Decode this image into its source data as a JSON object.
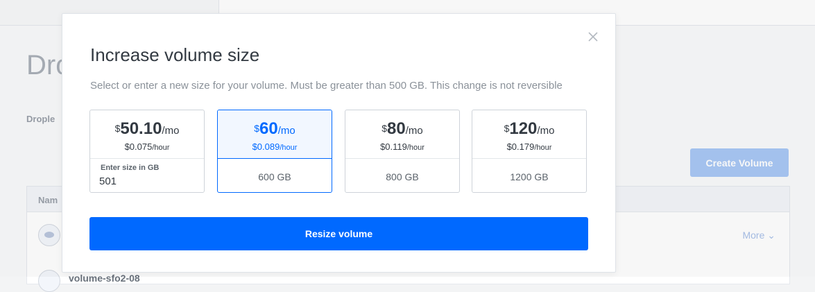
{
  "background": {
    "page_title": "Drop",
    "tab_label": "Drople",
    "create_button_label": "Create Volume",
    "table_col_name": "Nam",
    "row_more_label": "More",
    "row2_name": "volume-sfo2-08"
  },
  "modal": {
    "title": "Increase volume size",
    "description": "Select or enter a new size for your volume. Must be greater than 500 GB. This change is not reversible",
    "options": [
      {
        "currency": "$",
        "price": "50.10",
        "per_month": "/mo",
        "hourly": "$0.075",
        "per_hour": "/hour",
        "custom_label": "Enter size in GB",
        "custom_value": "501",
        "selected": false
      },
      {
        "currency": "$",
        "price": "60",
        "per_month": "/mo",
        "hourly": "$0.089",
        "per_hour": "/hour",
        "size": "600 GB",
        "selected": true
      },
      {
        "currency": "$",
        "price": "80",
        "per_month": "/mo",
        "hourly": "$0.119",
        "per_hour": "/hour",
        "size": "800 GB",
        "selected": false
      },
      {
        "currency": "$",
        "price": "120",
        "per_month": "/mo",
        "hourly": "$0.179",
        "per_hour": "/hour",
        "size": "1200 GB",
        "selected": false
      }
    ],
    "resize_button_label": "Resize volume",
    "close_icon": "close-icon"
  },
  "colors": {
    "primary": "#0069ff",
    "selected_bg": "#f2f7ff",
    "border": "#ced3d9",
    "muted_text": "#8a9199",
    "create_disabled": "#a9c8f5"
  }
}
